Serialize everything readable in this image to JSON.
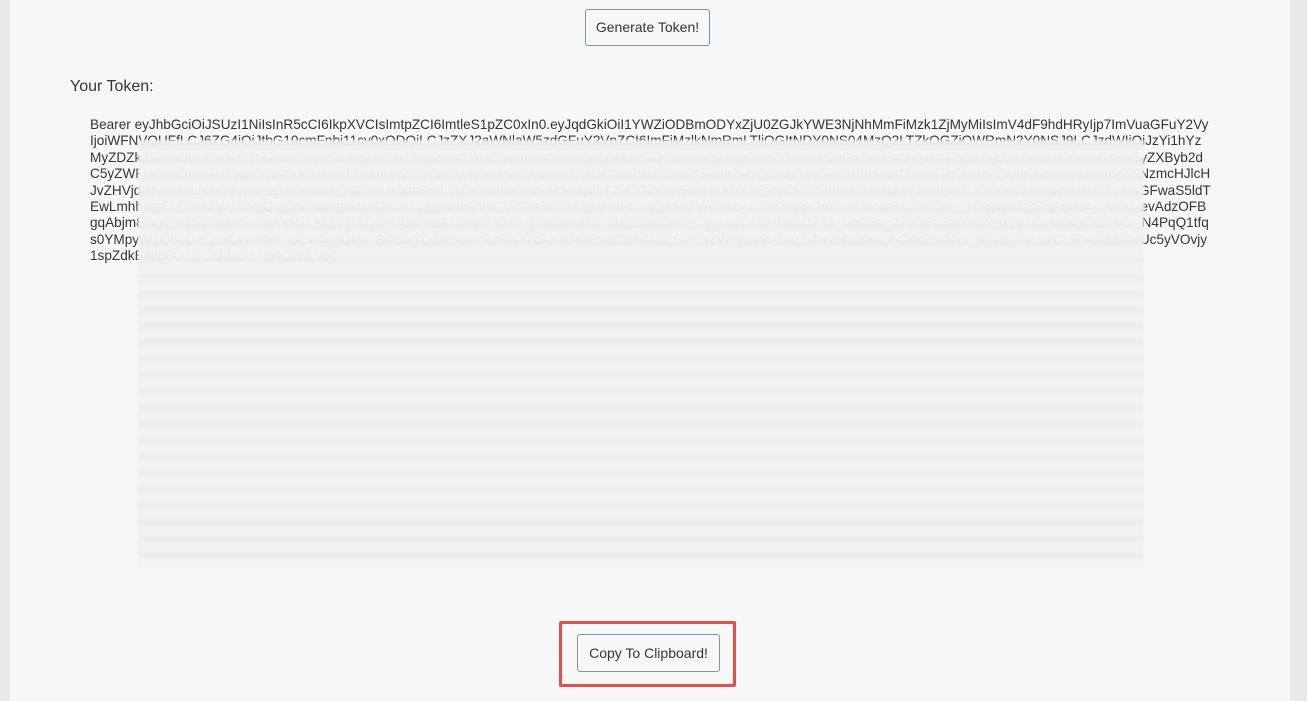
{
  "header": {
    "generate_button_label": "Generate Token!"
  },
  "token": {
    "label": "Your Token:",
    "value": "Bearer eyJhbGciOiJSUzI1NiIsInR5cCI6IkpXVCIsImtpZCI6ImtleS1pZC0xIn0.eyJqdGkiOiI1YWZiODBmODYxZjU0ZGJkYWE3NjNhMmFiMzk1ZjMyMiIsImV4dF9hdHRyIjp7ImVuaGFuY2VyIjoiWFNVQUFfLCJ6ZG4iOiJtbG10cmFnbi11cy0xODQiLCJzZXJ2aWNlaW5zdGFuY2VpZCI6ImFiMzlkNmRmLTljOGItNDY0NS04MzQ2LTZkOGZiOWRmN2Y0NSJ9LCJzdWIiOiJzYi1hYzMyZDZkZi0aW9uLXN0ZC1tZ2Uud3JpdGUiLCJN0b3JhZ2VhcGkuZWcmVwcm9kdWlvbi1zdGQtbWxmdCJmb3VuZGF0aW9uGlvbmFsc2VydmljZvZHVjdGlvbiFiMTYkLW1sZnByZXByb2dC5yZWFkkliwiZmWFuYWdlbWVudCbiFiMTY0Lm1vZGW9kdWN0aW9uIWI24tc3RkLW1sZnByb2R1Y3Rpb24hYjEndyYW50X3R5cGUdXMtMTg0LmxvYWtbGZwcmVwcm9jZXNzmcHJlcHJvZHVjdGlvbiIsImNsaWVudF9pZCI6InNiLWFjMzJkNmRmLTljOGItNDY0NS04MzQ2LTZkOGZiOWRmN2Y0NSE2NC5tb2RlbGRlcGxveW1lbnQiLCJ0aXNzIjoiaHR0cHM6Ly9tbGFwaS5ldTEwLmhhbmEub25kZW1hbmQuY29tIiwiemlkIjoiODdkL7FHbHcGV0CW5kb3dBRElHaHdFcXdjQk53ZVAt8tkb_c0BKanjYr2m0Lfl9kiorpRL303EeP_TOYpYiUrPSHAg0d4_vVzlrLievAdzOFBgqAbjm8mgfPBfj5qRHka5cs9WkRx1YOj9TMTmFUj36NmALhUwBYM9-l7sdzlRe0FfFJlVkjIsgdO59FCYyLxzCDqPNJ2OZT8_5oO3o_27JGRp3aGWWHVpjlU5_8trwgEmE4Gi_N4PqQ1tfqs0YMpyW1Q8uD-E2mCVoY6m_UEw4ggQxjo_Sdl5wYQlf0rNprmk4RNYccKp7D8aPxaCD6dkBEG7zhjZW9pee9t-ZkqT-TwZHUiKkapFOdeFhrMyv_bTvB7frkLozOLRVqyXb3MUc5yVOvjy1spZdkB8jIp8GzG-2UdoD47fb4QhtILv60"
  },
  "footer": {
    "copy_button_label": "Copy To Clipboard!"
  },
  "highlight_color": "#e4504b"
}
